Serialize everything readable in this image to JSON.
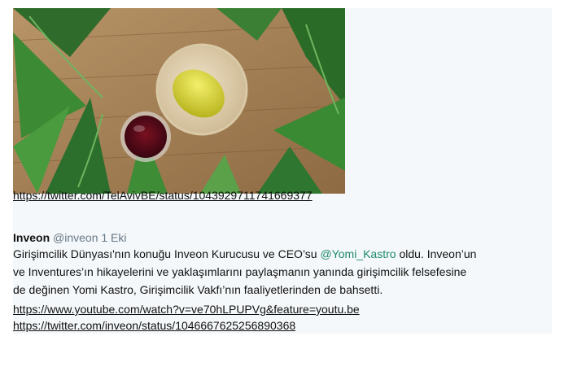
{
  "embedded_image": {
    "description_icon": "photo-icon"
  },
  "links": {
    "tel_aviv_status": "https://twitter.com/TelAvivBE/status/1043929711741669377",
    "youtube": "https://www.youtube.com/watch?v=ve70hLPUPVg&feature=youtu.be",
    "inveon_status": "https://twitter.com/inveon/status/1046667625256890368"
  },
  "tweet": {
    "author": "Inveon",
    "handle": "@inveon",
    "date": "1 Eki",
    "line1_prefix": "Girişimcilik Dünyası'nın konuğu Inveon Kurucusu ve CEO’su ",
    "mention": "@Yomi_Kastro",
    "line1_suffix": " oldu. Inveon’un",
    "line2": "ve Inventures’ın hikayelerini ve yaklaşımlarını paylaşmanın yanında girişimcilik felsefesine",
    "line3": "de değinen Yomi Kastro, Girişimcilik Vakfı’nın faaliyetlerinden de bahsetti."
  },
  "colors": {
    "link": "#1a0dab",
    "mention": "#1b8a6b",
    "panel_bg": "#f5f8fa"
  }
}
